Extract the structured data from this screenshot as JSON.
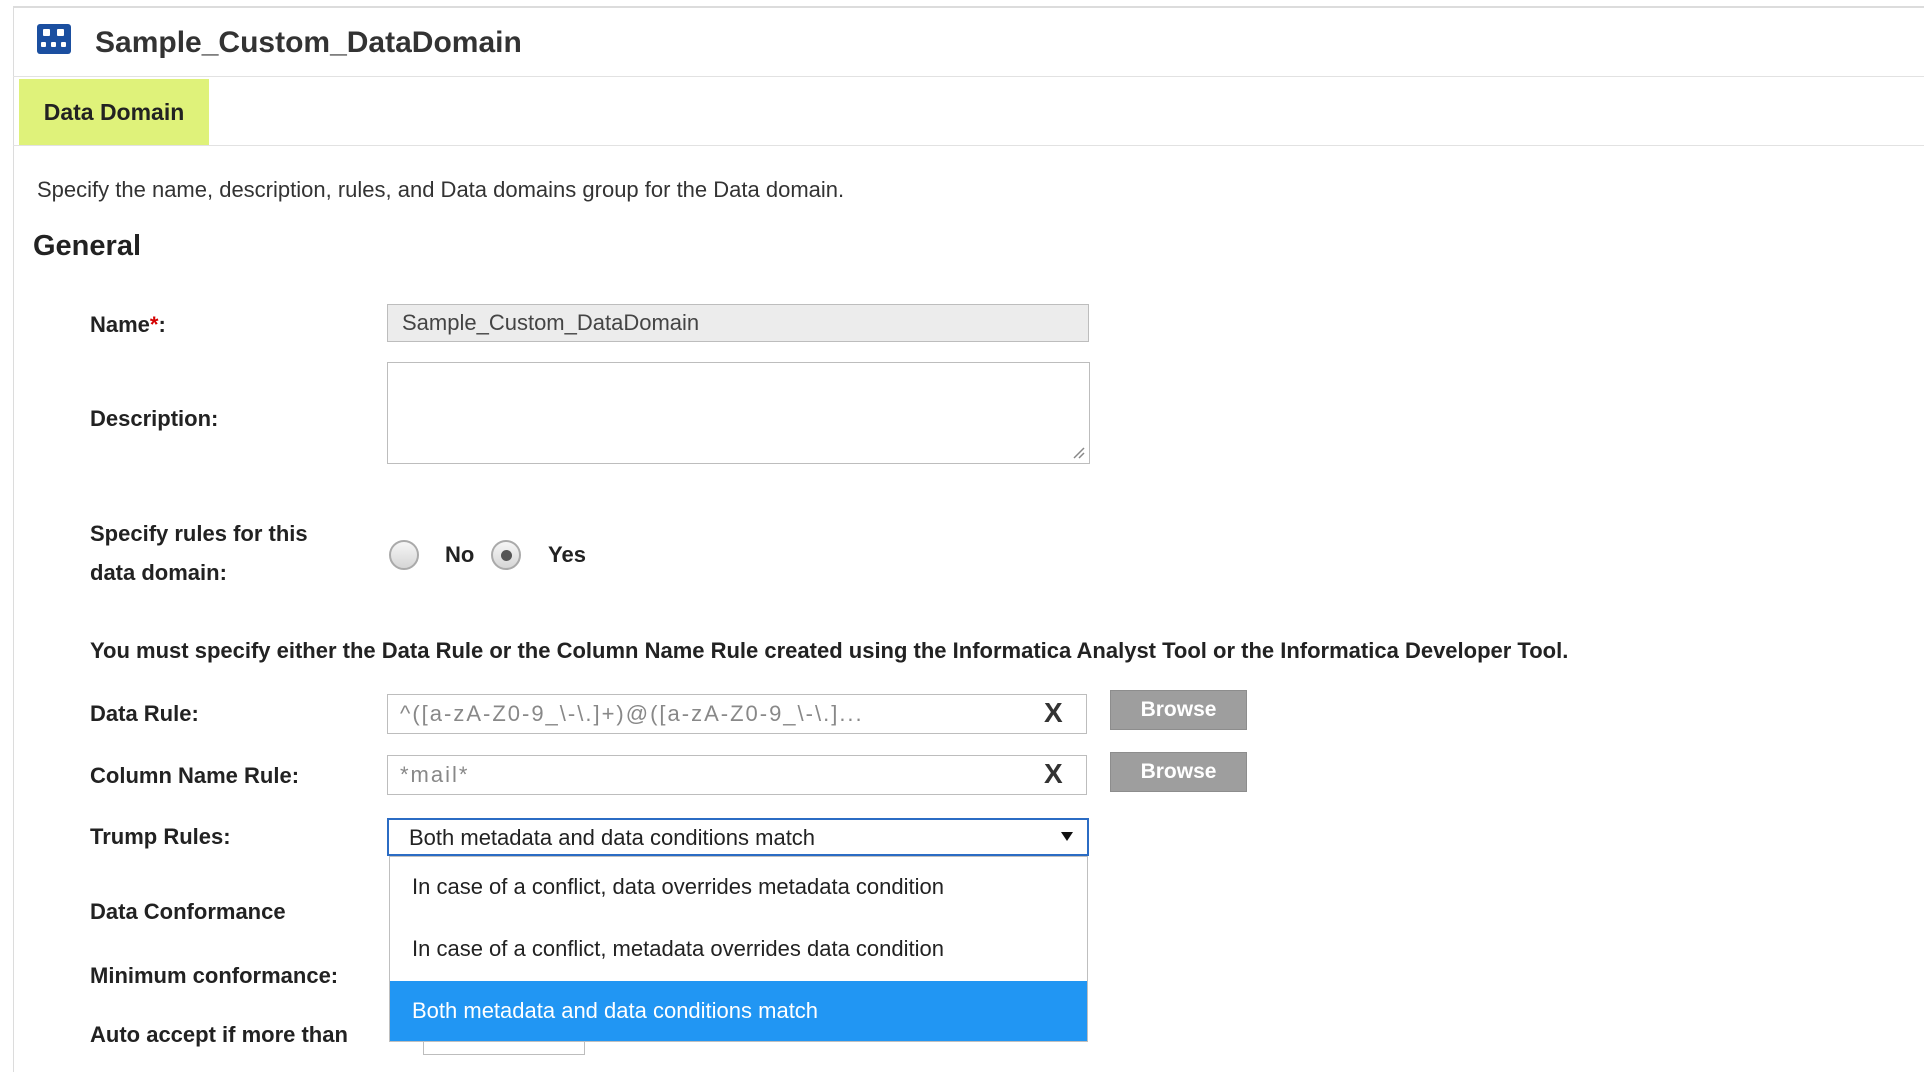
{
  "header": {
    "title": "Sample_Custom_DataDomain"
  },
  "tabs": [
    {
      "label": "Data Domain"
    }
  ],
  "intro": "Specify the name, description, rules, and Data domains group for the Data domain.",
  "section": "General",
  "form": {
    "name_label": "Name",
    "name_required_mark": "*",
    "name_colon": ":",
    "name_value": "Sample_Custom_DataDomain",
    "description_label": "Description:",
    "description_value": "",
    "specify_rules_label_line1": "Specify rules for this",
    "specify_rules_label_line2": "data domain:",
    "radio_no": "No",
    "radio_yes": "Yes",
    "radio_selected": "Yes",
    "warning": "You must specify either the Data Rule or the Column Name Rule created using the Informatica Analyst Tool or the Informatica Developer Tool.",
    "data_rule_label": "Data Rule:",
    "data_rule_value": "^([a-zA-Z0-9_\\-\\.]+)@([a-zA-Z0-9_\\-\\.]...",
    "column_name_rule_label": "Column Name Rule:",
    "column_name_rule_value": "*mail*",
    "clear_glyph": "X",
    "browse_label": "Browse",
    "trump_rules_label": "Trump Rules:",
    "trump_rules_value": "Both metadata and data conditions match",
    "trump_rules_options": [
      "In case of a conflict, data overrides metadata condition",
      "In case of a conflict, metadata overrides data condition",
      "Both metadata and data conditions match"
    ],
    "data_conformance_label": "Data Conformance",
    "minimum_conformance_label": "Minimum conformance:",
    "auto_accept_label": "Auto accept if more than"
  },
  "colors": {
    "tab_active": "#dff27a",
    "selection": "#2196f3",
    "button_gray": "#9e9e9e",
    "focus_border": "#2b6cc4"
  }
}
